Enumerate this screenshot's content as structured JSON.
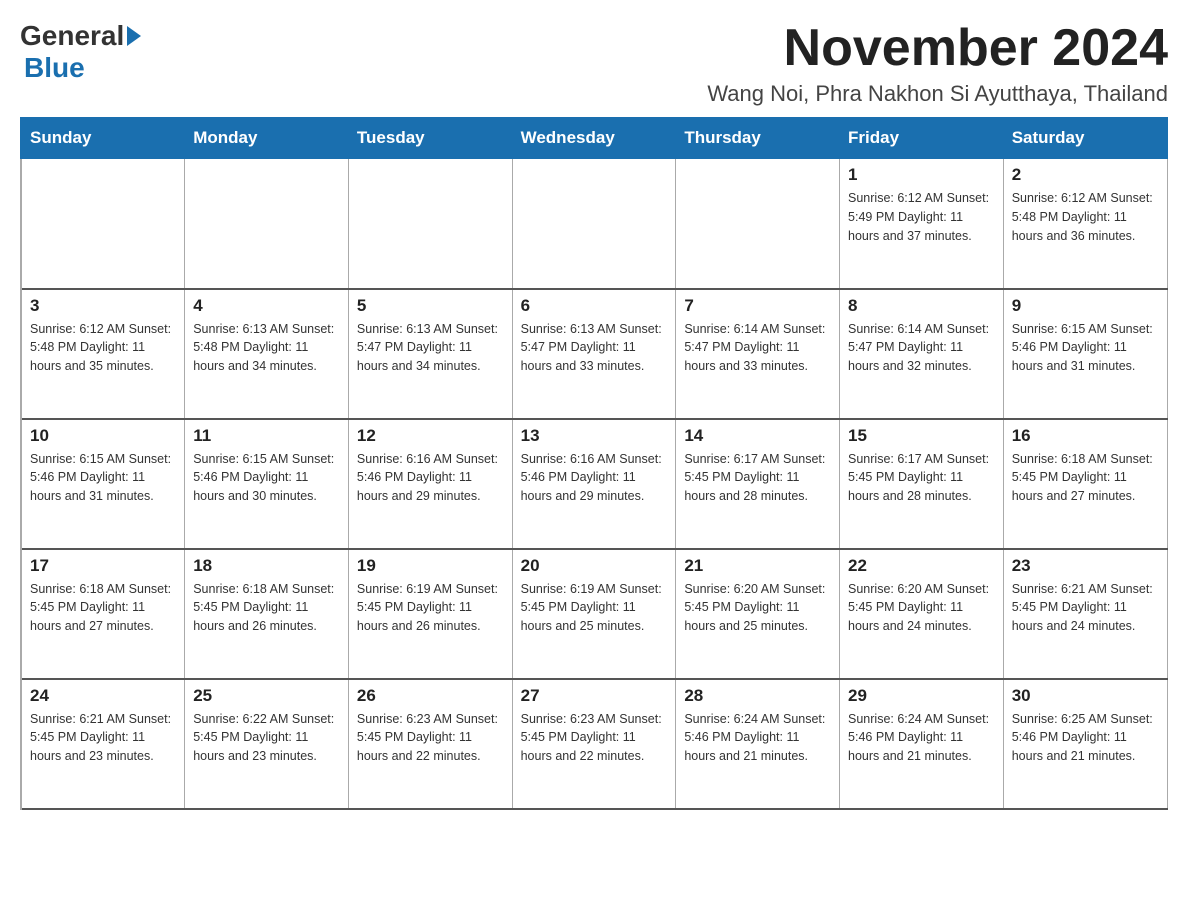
{
  "header": {
    "logo_general": "General",
    "logo_blue": "Blue",
    "month_title": "November 2024",
    "location": "Wang Noi, Phra Nakhon Si Ayutthaya, Thailand"
  },
  "weekdays": [
    "Sunday",
    "Monday",
    "Tuesday",
    "Wednesday",
    "Thursday",
    "Friday",
    "Saturday"
  ],
  "weeks": [
    [
      {
        "day": "",
        "info": ""
      },
      {
        "day": "",
        "info": ""
      },
      {
        "day": "",
        "info": ""
      },
      {
        "day": "",
        "info": ""
      },
      {
        "day": "",
        "info": ""
      },
      {
        "day": "1",
        "info": "Sunrise: 6:12 AM\nSunset: 5:49 PM\nDaylight: 11 hours\nand 37 minutes."
      },
      {
        "day": "2",
        "info": "Sunrise: 6:12 AM\nSunset: 5:48 PM\nDaylight: 11 hours\nand 36 minutes."
      }
    ],
    [
      {
        "day": "3",
        "info": "Sunrise: 6:12 AM\nSunset: 5:48 PM\nDaylight: 11 hours\nand 35 minutes."
      },
      {
        "day": "4",
        "info": "Sunrise: 6:13 AM\nSunset: 5:48 PM\nDaylight: 11 hours\nand 34 minutes."
      },
      {
        "day": "5",
        "info": "Sunrise: 6:13 AM\nSunset: 5:47 PM\nDaylight: 11 hours\nand 34 minutes."
      },
      {
        "day": "6",
        "info": "Sunrise: 6:13 AM\nSunset: 5:47 PM\nDaylight: 11 hours\nand 33 minutes."
      },
      {
        "day": "7",
        "info": "Sunrise: 6:14 AM\nSunset: 5:47 PM\nDaylight: 11 hours\nand 33 minutes."
      },
      {
        "day": "8",
        "info": "Sunrise: 6:14 AM\nSunset: 5:47 PM\nDaylight: 11 hours\nand 32 minutes."
      },
      {
        "day": "9",
        "info": "Sunrise: 6:15 AM\nSunset: 5:46 PM\nDaylight: 11 hours\nand 31 minutes."
      }
    ],
    [
      {
        "day": "10",
        "info": "Sunrise: 6:15 AM\nSunset: 5:46 PM\nDaylight: 11 hours\nand 31 minutes."
      },
      {
        "day": "11",
        "info": "Sunrise: 6:15 AM\nSunset: 5:46 PM\nDaylight: 11 hours\nand 30 minutes."
      },
      {
        "day": "12",
        "info": "Sunrise: 6:16 AM\nSunset: 5:46 PM\nDaylight: 11 hours\nand 29 minutes."
      },
      {
        "day": "13",
        "info": "Sunrise: 6:16 AM\nSunset: 5:46 PM\nDaylight: 11 hours\nand 29 minutes."
      },
      {
        "day": "14",
        "info": "Sunrise: 6:17 AM\nSunset: 5:45 PM\nDaylight: 11 hours\nand 28 minutes."
      },
      {
        "day": "15",
        "info": "Sunrise: 6:17 AM\nSunset: 5:45 PM\nDaylight: 11 hours\nand 28 minutes."
      },
      {
        "day": "16",
        "info": "Sunrise: 6:18 AM\nSunset: 5:45 PM\nDaylight: 11 hours\nand 27 minutes."
      }
    ],
    [
      {
        "day": "17",
        "info": "Sunrise: 6:18 AM\nSunset: 5:45 PM\nDaylight: 11 hours\nand 27 minutes."
      },
      {
        "day": "18",
        "info": "Sunrise: 6:18 AM\nSunset: 5:45 PM\nDaylight: 11 hours\nand 26 minutes."
      },
      {
        "day": "19",
        "info": "Sunrise: 6:19 AM\nSunset: 5:45 PM\nDaylight: 11 hours\nand 26 minutes."
      },
      {
        "day": "20",
        "info": "Sunrise: 6:19 AM\nSunset: 5:45 PM\nDaylight: 11 hours\nand 25 minutes."
      },
      {
        "day": "21",
        "info": "Sunrise: 6:20 AM\nSunset: 5:45 PM\nDaylight: 11 hours\nand 25 minutes."
      },
      {
        "day": "22",
        "info": "Sunrise: 6:20 AM\nSunset: 5:45 PM\nDaylight: 11 hours\nand 24 minutes."
      },
      {
        "day": "23",
        "info": "Sunrise: 6:21 AM\nSunset: 5:45 PM\nDaylight: 11 hours\nand 24 minutes."
      }
    ],
    [
      {
        "day": "24",
        "info": "Sunrise: 6:21 AM\nSunset: 5:45 PM\nDaylight: 11 hours\nand 23 minutes."
      },
      {
        "day": "25",
        "info": "Sunrise: 6:22 AM\nSunset: 5:45 PM\nDaylight: 11 hours\nand 23 minutes."
      },
      {
        "day": "26",
        "info": "Sunrise: 6:23 AM\nSunset: 5:45 PM\nDaylight: 11 hours\nand 22 minutes."
      },
      {
        "day": "27",
        "info": "Sunrise: 6:23 AM\nSunset: 5:45 PM\nDaylight: 11 hours\nand 22 minutes."
      },
      {
        "day": "28",
        "info": "Sunrise: 6:24 AM\nSunset: 5:46 PM\nDaylight: 11 hours\nand 21 minutes."
      },
      {
        "day": "29",
        "info": "Sunrise: 6:24 AM\nSunset: 5:46 PM\nDaylight: 11 hours\nand 21 minutes."
      },
      {
        "day": "30",
        "info": "Sunrise: 6:25 AM\nSunset: 5:46 PM\nDaylight: 11 hours\nand 21 minutes."
      }
    ]
  ]
}
